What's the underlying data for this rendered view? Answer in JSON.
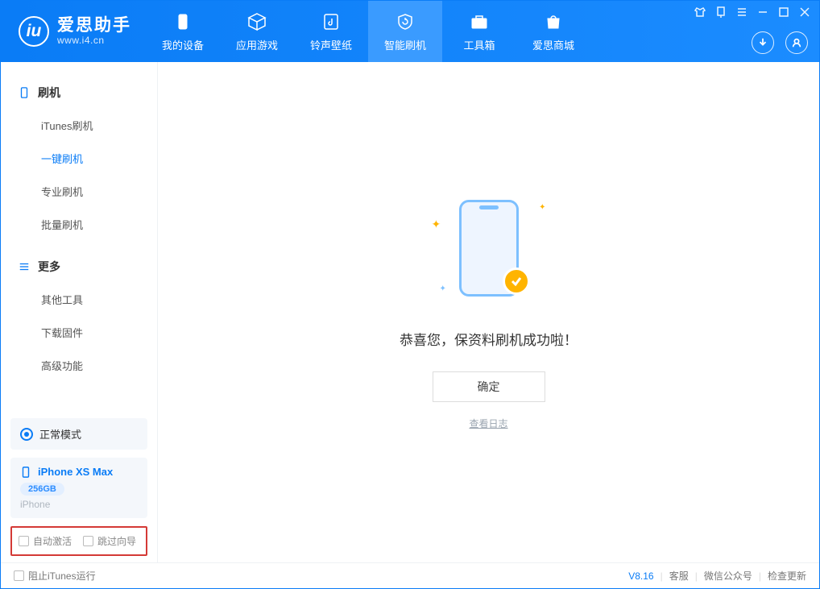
{
  "app": {
    "title": "爱思助手",
    "subtitle": "www.i4.cn"
  },
  "header_tabs": [
    {
      "label": "我的设备"
    },
    {
      "label": "应用游戏"
    },
    {
      "label": "铃声壁纸"
    },
    {
      "label": "智能刷机"
    },
    {
      "label": "工具箱"
    },
    {
      "label": "爱思商城"
    }
  ],
  "sidebar": {
    "g1": {
      "title": "刷机"
    },
    "items1": [
      {
        "label": "iTunes刷机"
      },
      {
        "label": "一键刷机"
      },
      {
        "label": "专业刷机"
      },
      {
        "label": "批量刷机"
      }
    ],
    "g2": {
      "title": "更多"
    },
    "items2": [
      {
        "label": "其他工具"
      },
      {
        "label": "下载固件"
      },
      {
        "label": "高级功能"
      }
    ],
    "status": {
      "label": "正常模式"
    },
    "device": {
      "name": "iPhone XS Max",
      "storage": "256GB",
      "type": "iPhone"
    },
    "checks": {
      "auto_activate": "自动激活",
      "skip_guide": "跳过向导"
    }
  },
  "main": {
    "message": "恭喜您，保资料刷机成功啦！",
    "ok_label": "确定",
    "log_label": "查看日志"
  },
  "footer": {
    "block_itunes": "阻止iTunes运行",
    "version": "V8.16",
    "links": {
      "service": "客服",
      "wechat": "微信公众号",
      "update": "检查更新"
    }
  }
}
